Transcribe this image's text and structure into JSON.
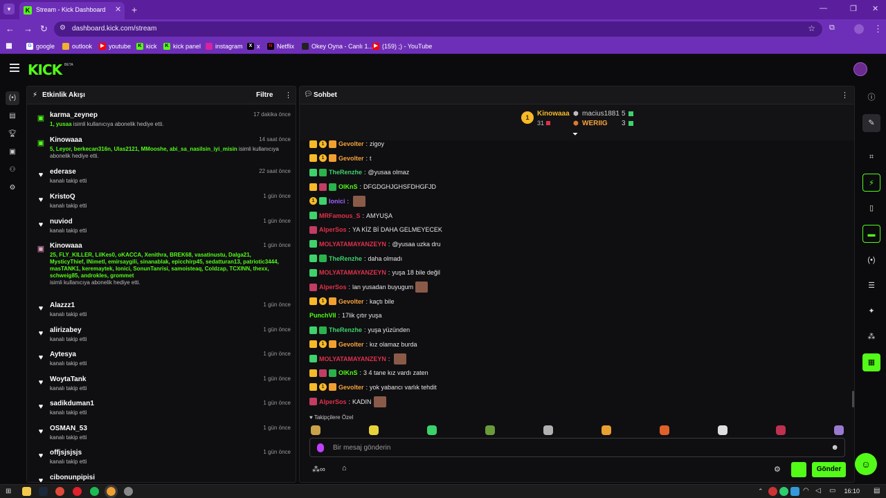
{
  "browser": {
    "tab_title": "Stream - Kick Dashboard",
    "url": "dashboard.kick.com/stream",
    "bookmarks": [
      "google",
      "outlook",
      "youtube",
      "kick",
      "kick panel",
      "instagram",
      "x",
      "Netflix",
      "Okey Oyna - Canlı 1...",
      "(159) ;) - YouTube"
    ]
  },
  "header": {
    "logo": "KICK",
    "beta": "BETA"
  },
  "activity": {
    "title": "Etkinlik Akışı",
    "filter": "Filtre",
    "items": [
      {
        "user": "karma_zeynep",
        "time": "17 dakika önce",
        "highlight": "1, yusaa",
        "desc": " isimli kullanıcıya abonelik hediye etti.",
        "icon": "gift-icon"
      },
      {
        "user": "Kinowaaa",
        "time": "14 saat önce",
        "highlight": "5, Leyor, berkecan316n, Ulas2121, MMooshe, abi_sa_nasilsin_iyi_misin",
        "desc": " isimli kullanıcıya abonelik hediye etti.",
        "icon": "gift-icon"
      },
      {
        "user": "ederase",
        "time": "22 saat önce",
        "highlight": "",
        "desc": "kanalı takip etti",
        "icon": "heart-icon"
      },
      {
        "user": "KristoQ",
        "time": "1 gün önce",
        "highlight": "",
        "desc": "kanalı takip etti",
        "icon": "heart-icon"
      },
      {
        "user": "nuviod",
        "time": "1 gün önce",
        "highlight": "",
        "desc": "kanalı takip etti",
        "icon": "heart-icon"
      },
      {
        "user": "Kinowaaa",
        "time": "1 gün önce",
        "highlight": "25, FLY_KILLER, LilKes0, oKACCA, Xenithra, BREK68, vasatinustu, Dalga21, MysticyThief, INimetl, emirsaygili, sinanablak, epicchirp45, sedatturan13, patriotic3444, masTANK1, keremaytek, Ionici, SonunTanrisi, samoisteaq, Coldzap, TCXINN, thexx, schweig85, androkles, grommet",
        "desc": "isimli kullanıcıya abonelik hediye etti.",
        "icon": "gift-icon"
      },
      {
        "user": "Alazzz1",
        "time": "1 gün önce",
        "highlight": "",
        "desc": "kanalı takip etti",
        "icon": "heart-icon"
      },
      {
        "user": "alirizabey",
        "time": "1 gün önce",
        "highlight": "",
        "desc": "kanalı takip etti",
        "icon": "heart-icon"
      },
      {
        "user": "Aytesya",
        "time": "1 gün önce",
        "highlight": "",
        "desc": "kanalı takip etti",
        "icon": "heart-icon"
      },
      {
        "user": "WoytaTank",
        "time": "1 gün önce",
        "highlight": "",
        "desc": "kanalı takip etti",
        "icon": "heart-icon"
      },
      {
        "user": "sadikduman1",
        "time": "1 gün önce",
        "highlight": "",
        "desc": "kanalı takip etti",
        "icon": "heart-icon"
      },
      {
        "user": "OSMAN_53",
        "time": "1 gün önce",
        "highlight": "",
        "desc": "kanalı takip etti",
        "icon": "heart-icon"
      },
      {
        "user": "offjsjsjsjs",
        "time": "1 gün önce",
        "highlight": "",
        "desc": "kanalı takip etti",
        "icon": "heart-icon"
      },
      {
        "user": "cibonunpipisi",
        "time": "",
        "highlight": "",
        "desc": "",
        "icon": "heart-icon"
      }
    ]
  },
  "chat": {
    "title": "Sohbet",
    "leaderboard": {
      "first": {
        "rank": "1",
        "name": "Kinowaaa",
        "count": "31"
      },
      "second": {
        "name": "macius1881",
        "count": "5"
      },
      "third": {
        "name": "WERIIG",
        "count": "3"
      }
    },
    "messages": [
      {
        "user": "Gevolter",
        "color": "#f7a23a",
        "badges": [
          "crown",
          "one",
          "gift"
        ],
        "text": "zigoy"
      },
      {
        "user": "Gevolter",
        "color": "#f7a23a",
        "badges": [
          "crown",
          "one",
          "gift"
        ],
        "text": "t"
      },
      {
        "user": "TheRenzhe",
        "color": "#3fd16b",
        "badges": [
          "green",
          "sub"
        ],
        "text": "@yusaa olmaz"
      },
      {
        "user": "OlKnS",
        "color": "#53fc18",
        "badges": [
          "crown",
          "red",
          "sub"
        ],
        "text": "DFGDGHJGHSFDHGFJD"
      },
      {
        "user": "Ionici",
        "color": "#a060ff",
        "badges": [
          "one",
          "green"
        ],
        "text": "",
        "emote": true
      },
      {
        "user": "MRFamous_S",
        "color": "#e0304a",
        "badges": [
          "green"
        ],
        "text": "AMYUŞA"
      },
      {
        "user": "AlperSos",
        "color": "#e0304a",
        "badges": [
          "red"
        ],
        "text": "YA KİZ Bİ DAHA GELMEYECEK"
      },
      {
        "user": "MOLYATAMAYANZEYN",
        "color": "#e0304a",
        "badges": [
          "green"
        ],
        "text": "@yusaa uzka dru"
      },
      {
        "user": "TheRenzhe",
        "color": "#3fd16b",
        "badges": [
          "green",
          "sub"
        ],
        "text": "daha olmadı"
      },
      {
        "user": "MOLYATAMAYANZEYN",
        "color": "#e0304a",
        "badges": [
          "green"
        ],
        "text": "yuşa 18 bile değil"
      },
      {
        "user": "AlperSos",
        "color": "#e0304a",
        "badges": [
          "red"
        ],
        "text": "lan yusadan buyugum",
        "emote": true
      },
      {
        "user": "Gevolter",
        "color": "#f7a23a",
        "badges": [
          "crown",
          "one",
          "gift"
        ],
        "text": "kaçtı bile"
      },
      {
        "user": "PunchVII",
        "color": "#53fc18",
        "badges": [],
        "text": "17lik çıtır yuşa"
      },
      {
        "user": "TheRenzhe",
        "color": "#3fd16b",
        "badges": [
          "green",
          "sub"
        ],
        "text": "yuşa yüzünden"
      },
      {
        "user": "Gevolter",
        "color": "#f7a23a",
        "badges": [
          "crown",
          "one",
          "gift"
        ],
        "text": "kız olamaz burda"
      },
      {
        "user": "MOLYATAMAYANZEYN",
        "color": "#e0304a",
        "badges": [
          "green"
        ],
        "text": "",
        "emote": true
      },
      {
        "user": "OlKnS",
        "color": "#53fc18",
        "badges": [
          "crown",
          "red",
          "sub"
        ],
        "text": "3 4 tane kız vardı zaten"
      },
      {
        "user": "Gevolter",
        "color": "#f7a23a",
        "badges": [
          "crown",
          "one",
          "gift"
        ],
        "text": "yok yabancı varlık tehdit"
      },
      {
        "user": "AlperSos",
        "color": "#e0304a",
        "badges": [
          "red"
        ],
        "text": "KADIN",
        "emote": true
      }
    ],
    "emote_section": "Takipçilere Özel",
    "input_placeholder": "Bir mesaj gönderin",
    "send_label": "Gönder"
  },
  "taskbar": {
    "time": "16:10"
  }
}
